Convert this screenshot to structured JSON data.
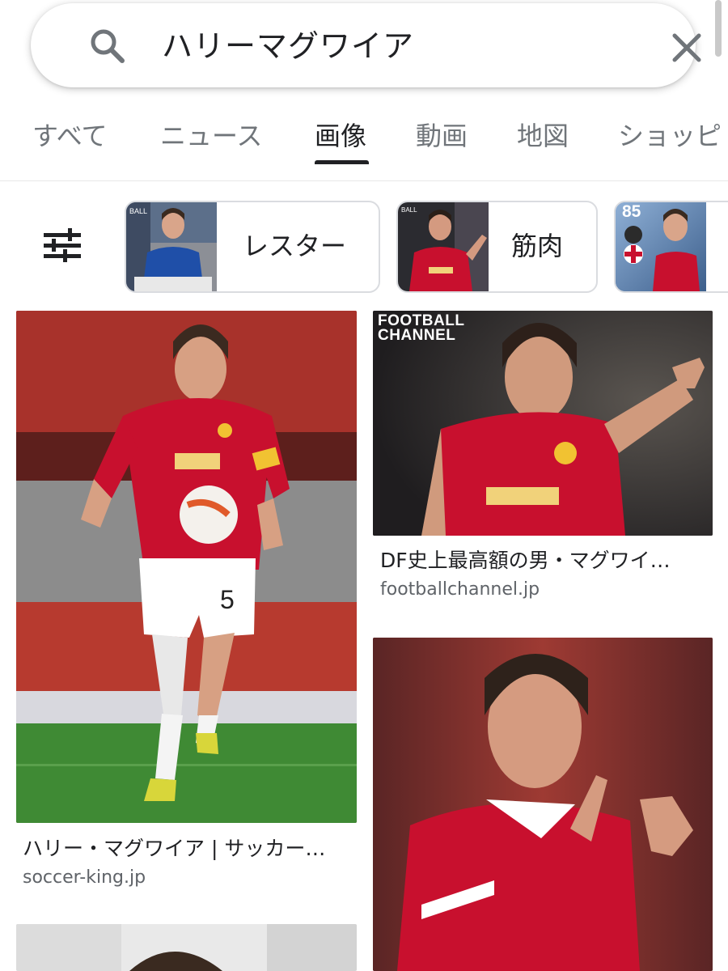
{
  "search": {
    "query": "ハリーマグワイア",
    "icon": "search-icon",
    "clear_icon": "close-icon"
  },
  "tabs": [
    {
      "label": "すべて",
      "active": false
    },
    {
      "label": "ニュース",
      "active": false
    },
    {
      "label": "画像",
      "active": true
    },
    {
      "label": "動画",
      "active": false
    },
    {
      "label": "地図",
      "active": false
    },
    {
      "label": "ショッピ",
      "active": false
    }
  ],
  "chips": [
    {
      "label": "レスター",
      "thumb": "player-in-leicester-kit"
    },
    {
      "label": "筋肉",
      "thumb": "player-in-red-kit"
    },
    {
      "label": "",
      "thumb": "game-player-card",
      "rating": "85"
    }
  ],
  "results": [
    {
      "title": "ハリー・マグワイア | サッカー…",
      "source": "soccer-king.jp"
    },
    {
      "title": "DF史上最高額の男・マグワイ…",
      "source": "footballchannel.jp",
      "badge": [
        "FOOTBALL",
        "CHANNEL"
      ]
    },
    {
      "title": "",
      "source": ""
    }
  ],
  "colors": {
    "kit_red": "#c8102e",
    "pitch_green": "#3f8a34",
    "leicester_blue": "#1f4fa8",
    "active_tab": "#202124",
    "inactive_tab": "#70757a"
  }
}
